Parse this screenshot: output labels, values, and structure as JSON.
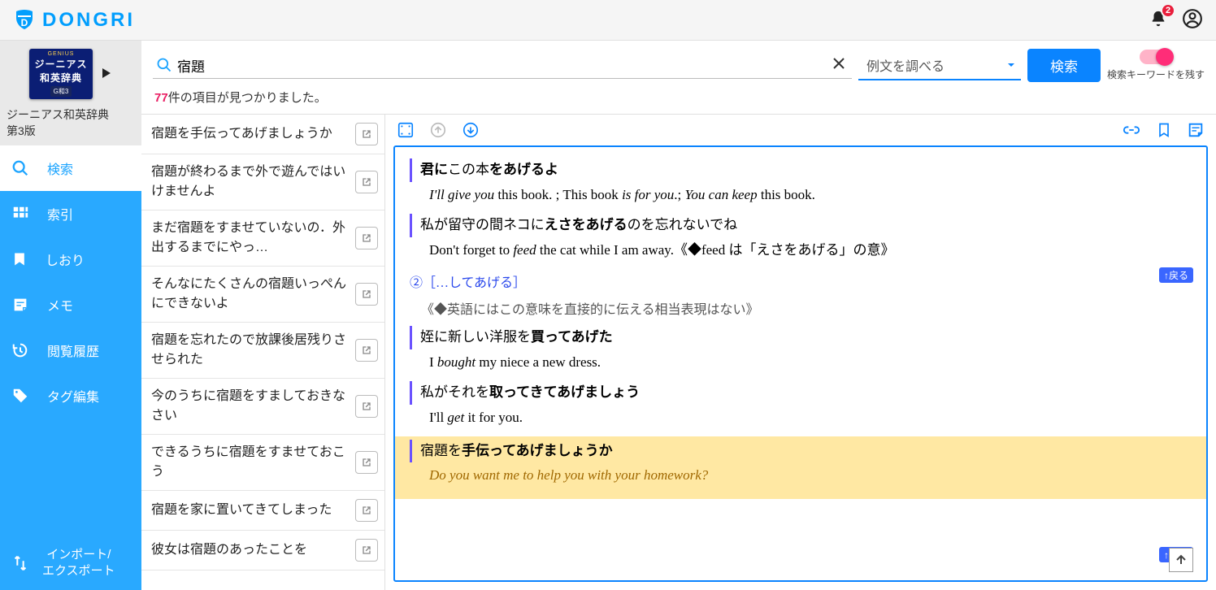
{
  "brand": "DONGRI",
  "notifications": "2",
  "dictionary": {
    "brand": "GENIUS",
    "name_l1": "ジーニアス",
    "name_l2": "和英辞典",
    "tag": "G和3",
    "full_name": "ジーニアス和英辞典\n第3版"
  },
  "nav": {
    "search": "検索",
    "index": "索引",
    "bookmark": "しおり",
    "memo": "メモ",
    "history": "閲覧履歴",
    "tag": "タグ編集",
    "io": "インポート/\nエクスポート"
  },
  "search": {
    "query": "宿題",
    "mode": "例文を調べる",
    "button": "検索",
    "toggle_label": "検索キーワードを残す",
    "count": "77",
    "count_suffix": "件の項目が見つかりました。"
  },
  "results": [
    "宿題を手伝ってあげましょうか",
    "宿題が終わるまで外で遊んではいけませんよ",
    "まだ宿題をすませていないの．外出するまでにやっ…",
    "そんなにたくさんの宿題いっぺんにできないよ",
    "宿題を忘れたので放課後居残りさせられた",
    "今のうちに宿題をすましておきなさい",
    "できるうちに宿題をすませておこう",
    "宿題を家に置いてきてしまった",
    "彼女は宿題のあったことを"
  ],
  "detail": {
    "back_label": "↑戻る",
    "entries_top": [
      {
        "je_html": "<b>君に</b>この本<b>をあげるよ</b>",
        "en_html": "<i>I'll give you</i> this book. ; This book <i>is for you</i>.; <i>You can keep</i> this book."
      },
      {
        "je_html": "私が留守の間ネコに<b>えさをあげる</b>のを忘れないでね",
        "en_html": "Don't forget to <i>feed</i> the cat while I am away.《◆feed は「えさをあげる」の意》"
      }
    ],
    "sense2_head": "②［…してあげる］",
    "sense2_note": "《◆英語にはこの意味を直接的に伝える相当表現はない》",
    "entries_mid": [
      {
        "je_html": "姪に新しい洋服を<b>買ってあげた</b>",
        "en_html": "I <i>bought</i> my niece a new dress."
      },
      {
        "je_html": "私がそれを<b>取ってきてあげましょう</b>",
        "en_html": "I'll <i>get</i> it for you."
      }
    ],
    "highlighted": {
      "je_html": "宿題を<b>手伝ってあげましょうか</b>",
      "en_html": "<i>Do you want me to help you</i> with your homework?"
    }
  }
}
